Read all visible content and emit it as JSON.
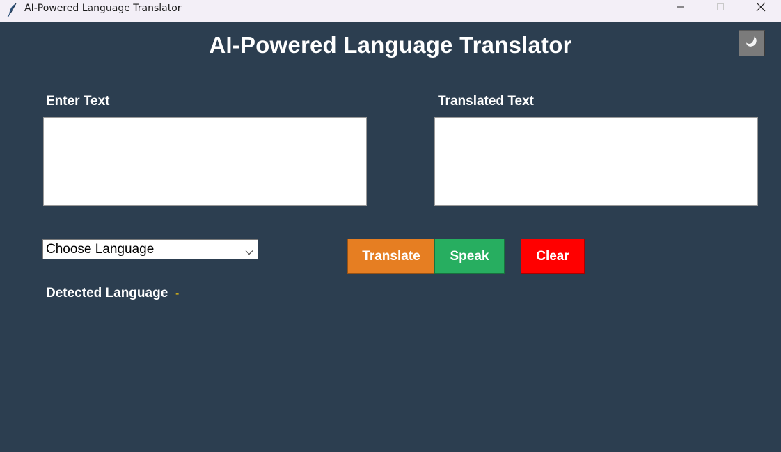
{
  "window": {
    "title": "AI-Powered Language Translator",
    "controls": {
      "minimize": "minimize-icon",
      "maximize": "maximize-icon",
      "close": "close-icon"
    }
  },
  "header": {
    "title": "AI-Powered Language Translator",
    "theme_toggle_icon": "moon-icon"
  },
  "input": {
    "label": "Enter Text",
    "value": ""
  },
  "output": {
    "label": "Translated Text",
    "value": ""
  },
  "language_select": {
    "selected": "Choose Language"
  },
  "buttons": {
    "translate": "Translate",
    "speak": "Speak",
    "clear": "Clear"
  },
  "detected": {
    "label": "Detected Language",
    "value": "-"
  },
  "colors": {
    "background": "#2c3e50",
    "translate": "#e67e22",
    "speak": "#27ae60",
    "clear": "#ff0000",
    "detected_value": "#f1c40f"
  }
}
